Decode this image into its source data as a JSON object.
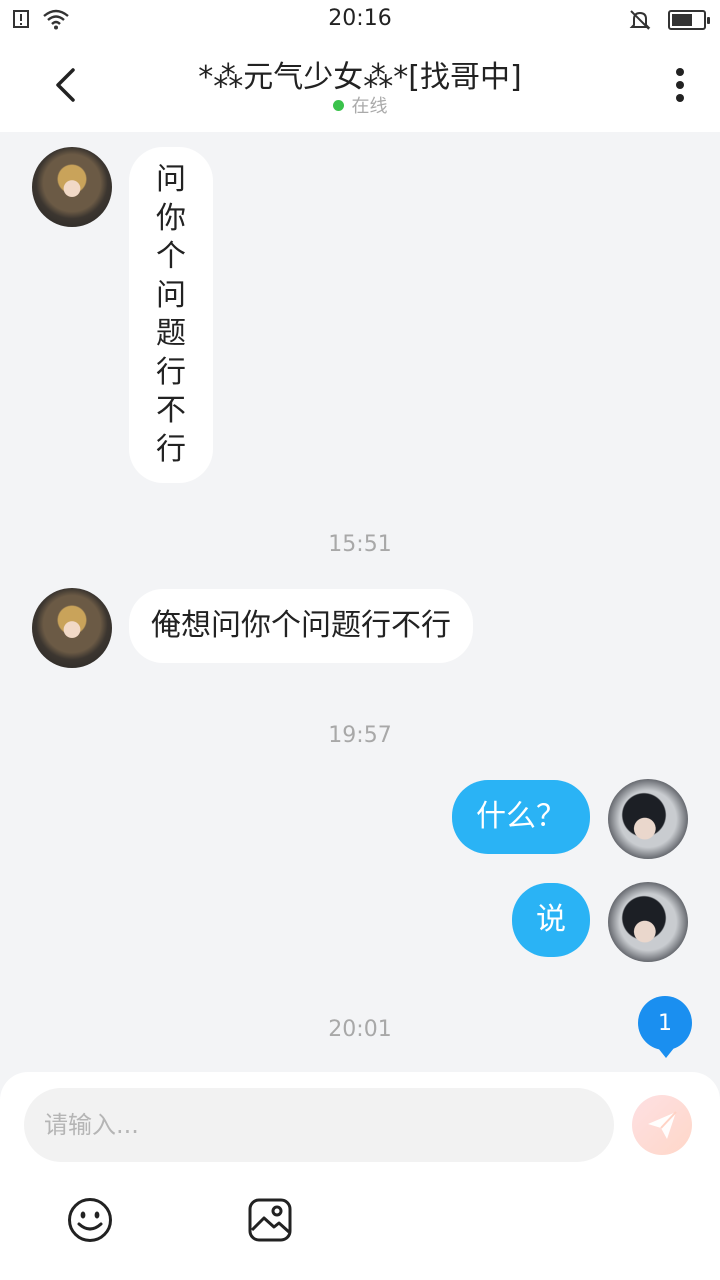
{
  "status_bar": {
    "time": "20:16"
  },
  "header": {
    "title": "*⁂元气少女⁂*[找哥中]",
    "status_text": "在线"
  },
  "messages": [
    {
      "side": "incoming",
      "orientation": "vertical",
      "chars": [
        "问",
        "你",
        "个",
        "问",
        "题",
        "行",
        "不",
        "行"
      ]
    },
    {
      "timestamp": "15:51"
    },
    {
      "side": "incoming",
      "text": "俺想问你个问题行不行"
    },
    {
      "timestamp": "19:57"
    },
    {
      "side": "outgoing",
      "text": "什么？"
    },
    {
      "side": "outgoing",
      "text": "说"
    },
    {
      "timestamp": "20:01"
    }
  ],
  "unread_badge": "1",
  "input": {
    "placeholder": "请输入..."
  },
  "colors": {
    "outgoing_bubble": "#2ab3f5",
    "incoming_bubble": "#ffffff",
    "online_dot": "#3ac24b",
    "badge": "#1a8ff0",
    "background": "#f3f4f6"
  },
  "icons": [
    "back-icon",
    "more-icon",
    "send-icon",
    "emoji-icon",
    "image-icon"
  ]
}
